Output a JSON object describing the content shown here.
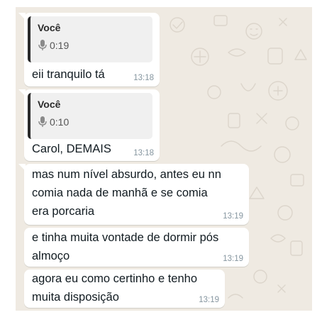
{
  "colors": {
    "wallpaper": "#efeae2",
    "bubble": "#ffffff",
    "quote_background": "#f0f0f0",
    "quote_bar": "#2a2a2a",
    "timestamp": "#8696a0"
  },
  "messages": [
    {
      "reply": {
        "author": "Você",
        "icon": "microphone-icon",
        "duration": "0:19"
      },
      "text": "eii tranquilo tá",
      "time": "13:18"
    },
    {
      "reply": {
        "author": "Você",
        "icon": "microphone-icon",
        "duration": "0:10"
      },
      "text": "Carol, DEMAIS",
      "time": "13:18"
    },
    {
      "text": "mas num nível absurdo, antes eu nn\ncomia nada de manhã e se comia\nera porcaria",
      "time": "13:19"
    },
    {
      "text": "e tinha muita vontade de dormir pós\nalmoço",
      "time": "13:19"
    },
    {
      "text": "agora eu como certinho e tenho\nmuita disposição",
      "time": "13:19"
    }
  ]
}
